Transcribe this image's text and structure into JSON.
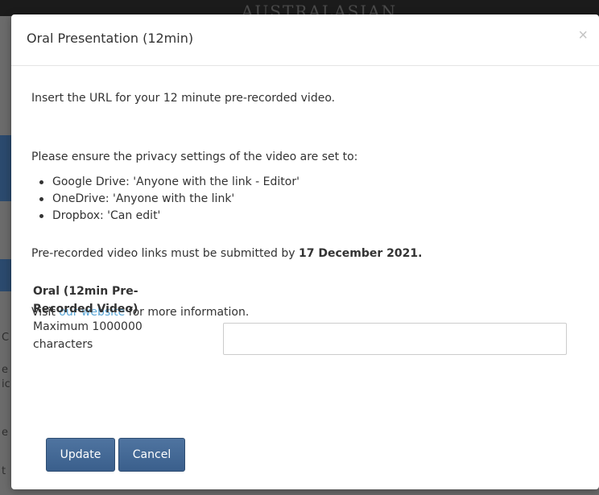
{
  "background": {
    "header_text": "AUSTRALASIAN",
    "side_letters": [
      "C",
      "e",
      "ic",
      "e",
      "t"
    ]
  },
  "modal": {
    "title": "Oral Presentation (12min)",
    "close_symbol": "×",
    "intro": "Insert the URL for your 12 minute pre-recorded video.",
    "privacy_intro": "Please ensure the privacy settings of the video are set to:",
    "privacy_items": [
      "Google Drive:  'Anyone with the link - Editor'",
      "OneDrive: 'Anyone with the link'",
      "Dropbox: 'Can edit'"
    ],
    "deadline_prefix": "Pre-recorded video links must be submitted by ",
    "deadline_date": "17 December 2021.",
    "visit_prefix": "Visit ",
    "visit_link": "our website",
    "visit_suffix": " for more information.",
    "field": {
      "label": "Oral (12min Pre-Recorded Video)",
      "hint": "Maximum 1000000 characters",
      "value": ""
    },
    "buttons": {
      "update": "Update",
      "cancel": "Cancel"
    }
  },
  "colors": {
    "button": "#3f6491",
    "link": "#5aa6d6"
  }
}
